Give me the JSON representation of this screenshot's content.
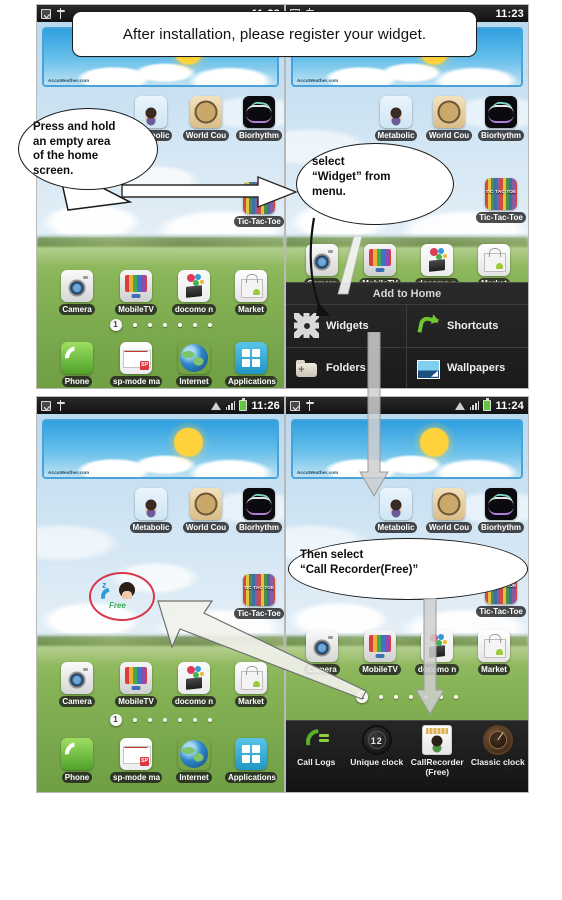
{
  "title_banner": {
    "text": "After installation, please register your widget."
  },
  "callouts": [
    {
      "id": "press-hold",
      "text": "Press and hold\nan empty area\nof the home\nscreen."
    },
    {
      "id": "select-widget",
      "text": "select\n“Widget” from\nmenu."
    },
    {
      "id": "then-select",
      "text": "Then select\n“Call Recorder(Free)”"
    }
  ],
  "panels": {
    "top_left": {
      "status": {
        "time": "11:23",
        "icons": [
          "notes-icon",
          "usb-icon"
        ]
      },
      "weather_widget": {
        "brand": "AccuWeather.com"
      },
      "apps_row1": [
        {
          "label": "Metabolic",
          "icon": "metabolic-icon"
        },
        {
          "label": "World Cou",
          "icon": "world-clock-icon"
        },
        {
          "label": "Biorhythm",
          "icon": "biorhythm-icon"
        }
      ],
      "apps_row2": [
        {
          "label": "Tic-Tac-Toe",
          "icon": "tic-tac-toe-icon",
          "badge": "TIC TAC TOE"
        }
      ],
      "apps_row3": [
        {
          "label": "Camera",
          "icon": "camera-icon"
        },
        {
          "label": "MobileTV",
          "icon": "mobile-tv-icon"
        },
        {
          "label": "docomo n",
          "icon": "docomo-icon"
        },
        {
          "label": "Market",
          "icon": "market-icon"
        }
      ],
      "page_indicator": {
        "current": "1",
        "total": 7
      },
      "dock": [
        {
          "label": "Phone",
          "icon": "phone-icon"
        },
        {
          "label": "sp-mode ma",
          "icon": "mail-icon",
          "badge": "SP"
        },
        {
          "label": "Internet",
          "icon": "internet-icon"
        },
        {
          "label": "Applications",
          "icon": "applications-icon"
        }
      ]
    },
    "top_right": {
      "status": {
        "time": "11:23",
        "icons": [
          "notes-icon",
          "usb-icon"
        ]
      },
      "weather_widget": {
        "brand": "AccuWeather.com"
      },
      "apps_row1": [
        {
          "label": "Metabolic",
          "icon": "metabolic-icon"
        },
        {
          "label": "World Cou",
          "icon": "world-clock-icon"
        },
        {
          "label": "Biorhythm",
          "icon": "biorhythm-icon"
        }
      ],
      "apps_row2": [
        {
          "label": "Tic-Tac-Toe",
          "icon": "tic-tac-toe-icon",
          "badge": "TIC TAC TOE"
        }
      ],
      "apps_row3": [
        {
          "label": "Camera",
          "icon": "camera-icon"
        },
        {
          "label": "MobileTV",
          "icon": "mobile-tv-icon"
        },
        {
          "label": "docomo n",
          "icon": "docomo-icon"
        },
        {
          "label": "Market",
          "icon": "market-icon"
        }
      ],
      "add_to_home": {
        "title": "Add to Home",
        "items": [
          {
            "label": "Widgets",
            "icon": "widgets-gear-icon"
          },
          {
            "label": "Shortcuts",
            "icon": "shortcut-arrow-icon"
          },
          {
            "label": "Folders",
            "icon": "folder-plus-icon"
          },
          {
            "label": "Wallpapers",
            "icon": "wallpaper-image-icon"
          }
        ]
      }
    },
    "bottom_left": {
      "status": {
        "time": "11:26",
        "icons": [
          "notes-icon",
          "usb-icon",
          "wifi-icon",
          "signal-icon",
          "battery-icon"
        ]
      },
      "weather_widget": {
        "brand": "AccuWeather.com"
      },
      "apps_row1": [
        {
          "label": "Metabolic",
          "icon": "metabolic-icon"
        },
        {
          "label": "World Cou",
          "icon": "world-clock-icon"
        },
        {
          "label": "Biorhythm",
          "icon": "biorhythm-icon"
        }
      ],
      "apps_row2": [
        {
          "label": "Tic-Tac-Toe",
          "icon": "tic-tac-toe-icon",
          "badge": "TIC TAC TOE"
        }
      ],
      "placed_widget": {
        "name": "call-recorder-widget",
        "free_label": "Free",
        "sleep_label": "z",
        "highlight_color": "#d8374a"
      },
      "apps_row3": [
        {
          "label": "Camera",
          "icon": "camera-icon"
        },
        {
          "label": "MobileTV",
          "icon": "mobile-tv-icon"
        },
        {
          "label": "docomo n",
          "icon": "docomo-icon"
        },
        {
          "label": "Market",
          "icon": "market-icon"
        }
      ],
      "page_indicator": {
        "current": "1",
        "total": 7
      },
      "dock": [
        {
          "label": "Phone",
          "icon": "phone-icon"
        },
        {
          "label": "sp-mode ma",
          "icon": "mail-icon",
          "badge": "SP"
        },
        {
          "label": "Internet",
          "icon": "internet-icon"
        },
        {
          "label": "Applications",
          "icon": "applications-icon"
        }
      ]
    },
    "bottom_right": {
      "status": {
        "time": "11:24",
        "icons": [
          "notes-icon",
          "usb-icon",
          "wifi-icon",
          "signal-icon",
          "battery-icon"
        ]
      },
      "weather_widget": {
        "brand": "AccuWeather.com"
      },
      "apps_row1": [
        {
          "label": "Metabolic",
          "icon": "metabolic-icon"
        },
        {
          "label": "World Cou",
          "icon": "world-clock-icon"
        },
        {
          "label": "Biorhythm",
          "icon": "biorhythm-icon"
        }
      ],
      "apps_row2": [
        {
          "label": "Tic-Tac-Toe",
          "icon": "tic-tac-toe-icon",
          "badge": "TIC TAC TOE"
        }
      ],
      "apps_row3": [
        {
          "label": "Camera",
          "icon": "camera-icon"
        },
        {
          "label": "MobileTV",
          "icon": "mobile-tv-icon"
        },
        {
          "label": "docomo n",
          "icon": "docomo-icon"
        },
        {
          "label": "Market",
          "icon": "market-icon"
        }
      ],
      "page_indicator": {
        "current": "1",
        "total": 7
      },
      "widget_picker": [
        {
          "label": "Call Logs",
          "icon": "call-logs-icon"
        },
        {
          "label": "Unique clock",
          "icon": "unique-clock-icon",
          "face": "12"
        },
        {
          "label": "CallRecorder(Free)",
          "icon": "call-recorder-icon"
        },
        {
          "label": "Classic clock",
          "icon": "classic-clock-icon"
        }
      ]
    }
  },
  "colors": {
    "highlight_red": "#d8374a",
    "menu_dark": "#1f1f1f",
    "accent_green": "#6ec82e",
    "widget_border_blue": "#4aa3d8"
  }
}
